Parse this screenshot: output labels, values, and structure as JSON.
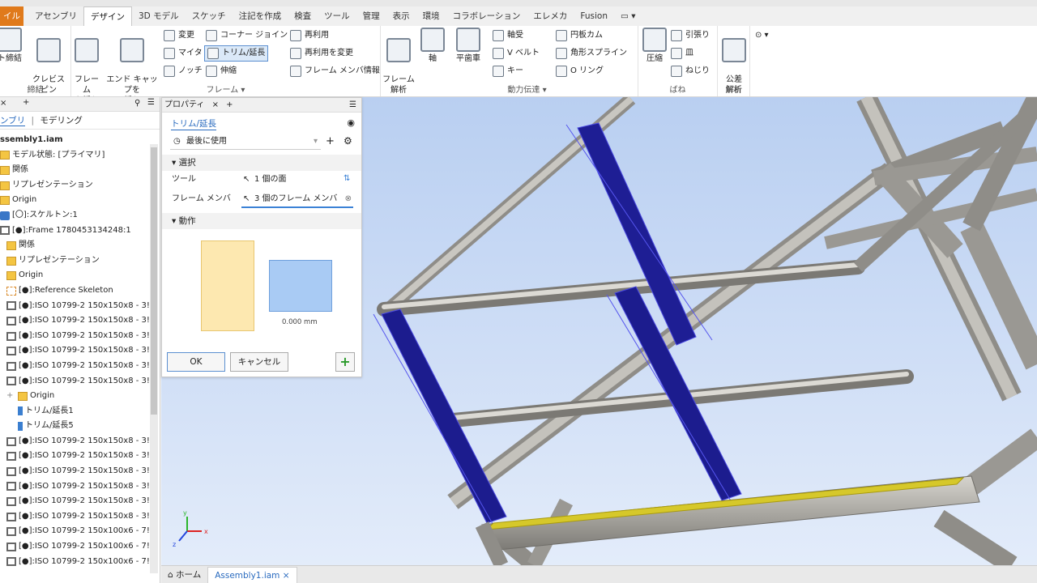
{
  "ribbon_tabs": [
    "イル",
    "アセンブリ",
    "デザイン",
    "3D モデル",
    "スケッチ",
    "注記を作成",
    "検査",
    "ツール",
    "管理",
    "表示",
    "環境",
    "コラボレーション",
    "エレメカ",
    "Fusion"
  ],
  "active_tab": "デザイン",
  "ribbon": {
    "group1": {
      "btn_label": "ト締結",
      "label": "締結"
    },
    "clevis_label": "クレビス\nピン",
    "frame_group": {
      "insert_frame": "フレーム\nを挿入",
      "insert_endcap": "エンド キャップを\n挿入",
      "change": "変更",
      "miter": "マイタ",
      "notch": "ノッチ",
      "corner_joint": "コーナー ジョイント",
      "trim_extend": "トリム/延長",
      "lengthen": "伸縮",
      "reuse": "再利用",
      "change_reuse": "再利用を変更",
      "member_info": "フレーム メンバ情報",
      "label": "フレーム ▾"
    },
    "frame_analysis": "フレーム\n解析",
    "power": {
      "shaft": "軸",
      "spur_gear": "平歯車",
      "bearing": "軸受",
      "vbelt": "V ベルト",
      "key": "キー",
      "disc_cam": "円板カム",
      "spline": "角形スプライン",
      "oring": "O リング",
      "label": "動力伝達 ▾"
    },
    "spring": {
      "compression": "圧縮",
      "tension": "引張り",
      "belleville": "皿",
      "torsion": "ねじり",
      "label": "ばね"
    },
    "analysis": {
      "tolerance": "公差\n解析",
      "label": "解析"
    }
  },
  "browser": {
    "sub_tabs": [
      "ンブリ",
      "モデリング"
    ],
    "items": [
      "ssembly1.iam",
      "モデル状態: [プライマリ]",
      "関係",
      "リプレゼンテーション",
      "Origin",
      "[〇]:スケルトン:1",
      "[●]:Frame 1780453134248:1",
      "関係",
      "リプレゼンテーション",
      "Origin",
      "[●]:Reference Skeleton",
      "[●]:ISO 10799-2 150x150x8 - 3!",
      "[●]:ISO 10799-2 150x150x8 - 3!",
      "[●]:ISO 10799-2 150x150x8 - 3!",
      "[●]:ISO 10799-2 150x150x8 - 3!",
      "[●]:ISO 10799-2 150x150x8 - 3!",
      "[●]:ISO 10799-2 150x150x8 - 3!",
      "Origin",
      "トリム/延長1",
      "トリム/延長5",
      "[●]:ISO 10799-2 150x150x8 - 3!",
      "[●]:ISO 10799-2 150x150x8 - 3!",
      "[●]:ISO 10799-2 150x150x8 - 3!",
      "[●]:ISO 10799-2 150x150x8 - 3!",
      "[●]:ISO 10799-2 150x150x8 - 3!",
      "[●]:ISO 10799-2 150x150x8 - 3!",
      "[●]:ISO 10799-2 150x100x6 - 7!",
      "[●]:ISO 10799-2 150x100x6 - 7!",
      "[●]:ISO 10799-2 150x100x6 - 7!"
    ]
  },
  "props": {
    "header": "プロパティ",
    "command": "トリム/延長",
    "preset": "最後に使用",
    "section_select": "選択",
    "tool_label": "ツール",
    "tool_value": "1 個の面",
    "members_label": "フレーム メンバ",
    "members_value": "3 個のフレーム メンバ",
    "section_action": "動作",
    "offset_value": "0.000 mm",
    "ok": "OK",
    "cancel": "キャンセル"
  },
  "doc_tabs": {
    "home": "ホーム",
    "active": "Assembly1.iam"
  },
  "colors": {
    "accent": "#2a6bbf",
    "selected_member": "#1a1a8c",
    "tool_face": "#d6c82a",
    "frame_gray": "#a8a6a0"
  }
}
